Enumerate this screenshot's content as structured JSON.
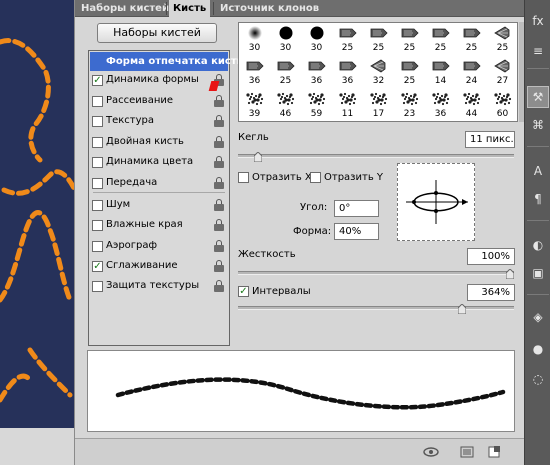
{
  "tabs": [
    {
      "label": "Наборы кистей",
      "active": false
    },
    {
      "label": "Кисть",
      "active": true
    },
    {
      "label": "Источник клонов",
      "active": false
    }
  ],
  "preset_button": "Наборы кистей",
  "options": {
    "header": "Форма отпечатка кисти",
    "items": [
      {
        "label": "Динамика формы",
        "checked": true,
        "locked": true
      },
      {
        "label": "Рассеивание",
        "checked": false,
        "locked": true
      },
      {
        "label": "Текстура",
        "checked": false,
        "locked": true
      },
      {
        "label": "Двойная кисть",
        "checked": false,
        "locked": true
      },
      {
        "label": "Динамика цвета",
        "checked": false,
        "locked": true
      },
      {
        "label": "Передача",
        "checked": false,
        "locked": true
      },
      {
        "label": "Шум",
        "checked": false,
        "locked": true
      },
      {
        "label": "Влажные края",
        "checked": false,
        "locked": true
      },
      {
        "label": "Аэрограф",
        "checked": false,
        "locked": true
      },
      {
        "label": "Сглаживание",
        "checked": true,
        "locked": true
      },
      {
        "label": "Защита текстуры",
        "checked": false,
        "locked": true
      }
    ]
  },
  "brush_tips": [
    {
      "size": "30",
      "kind": "soft"
    },
    {
      "size": "30",
      "kind": "hard"
    },
    {
      "size": "30",
      "kind": "hard"
    },
    {
      "size": "25",
      "kind": "marker"
    },
    {
      "size": "25",
      "kind": "marker"
    },
    {
      "size": "25",
      "kind": "marker"
    },
    {
      "size": "25",
      "kind": "marker"
    },
    {
      "size": "25",
      "kind": "marker"
    },
    {
      "size": "25",
      "kind": "fan"
    },
    {
      "size": "36",
      "kind": "marker"
    },
    {
      "size": "25",
      "kind": "marker"
    },
    {
      "size": "36",
      "kind": "marker"
    },
    {
      "size": "36",
      "kind": "marker"
    },
    {
      "size": "32",
      "kind": "fan"
    },
    {
      "size": "25",
      "kind": "marker"
    },
    {
      "size": "14",
      "kind": "marker"
    },
    {
      "size": "24",
      "kind": "marker"
    },
    {
      "size": "27",
      "kind": "fan"
    },
    {
      "size": "39",
      "kind": "splatter"
    },
    {
      "size": "46",
      "kind": "splatter"
    },
    {
      "size": "59",
      "kind": "splatter"
    },
    {
      "size": "11",
      "kind": "splatter"
    },
    {
      "size": "17",
      "kind": "splatter"
    },
    {
      "size": "23",
      "kind": "splatter"
    },
    {
      "size": "36",
      "kind": "splatter"
    },
    {
      "size": "44",
      "kind": "splatter"
    },
    {
      "size": "60",
      "kind": "splatter"
    }
  ],
  "size": {
    "label": "Кегль",
    "value": "11 пикс.",
    "fraction": 0.06
  },
  "flip_x": {
    "label": "Отразить X",
    "checked": false
  },
  "flip_y": {
    "label": "Отразить Y",
    "checked": false
  },
  "angle": {
    "label": "Угол:",
    "value": "0°"
  },
  "roundness": {
    "label": "Форма:",
    "value": "40%"
  },
  "hardness": {
    "label": "Жесткость",
    "value": "100%",
    "fraction": 1.0
  },
  "spacing": {
    "label": "Интервалы",
    "value": "364%",
    "checked": true,
    "fraction": 0.82
  },
  "colors": {
    "canvas_bg": "#26315a",
    "stitch": "#f08a1a",
    "selection": "#3d6bcf"
  },
  "toolbar_icons": [
    "fx-icon",
    "settings-icon",
    "brush-icon",
    "stamp-icon",
    "text-icon",
    "paragraph-icon",
    "adjustment-icon",
    "mask-icon",
    "layers-icon",
    "channels-icon",
    "paths-icon"
  ]
}
